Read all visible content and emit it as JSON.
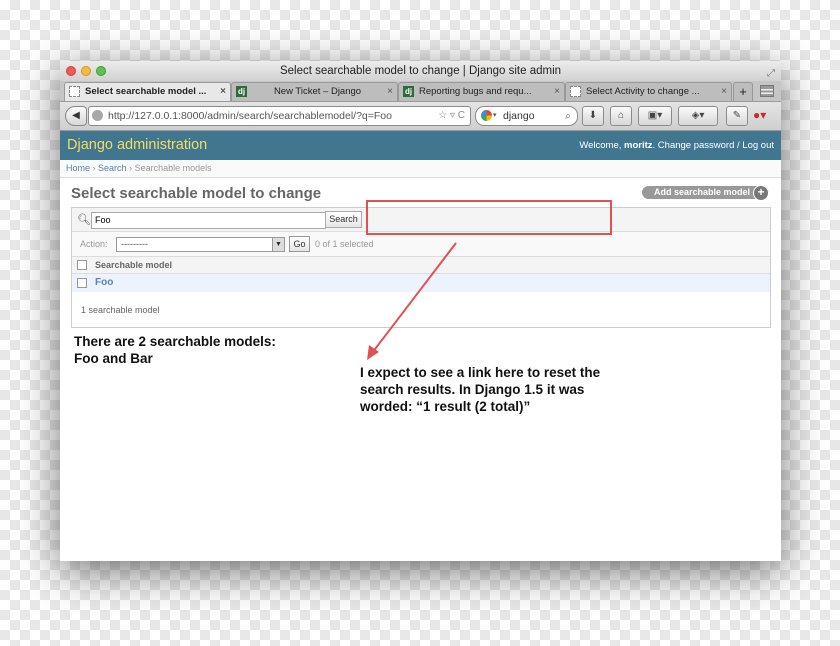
{
  "window": {
    "title": "Select searchable model to change | Django site admin",
    "resize_icon": "resize-icon"
  },
  "tabs": [
    {
      "label": "Select searchable model ...",
      "close": "×",
      "icon": "blank-page-icon",
      "active": true
    },
    {
      "label": "New Ticket – Django",
      "close": "×",
      "icon": "django-icon",
      "active": false
    },
    {
      "label": "Reporting bugs and requ...",
      "close": "×",
      "icon": "django-icon",
      "active": false
    },
    {
      "label": "Select Activity to change ...",
      "close": "×",
      "icon": "blank-page-icon",
      "active": false
    }
  ],
  "tab_plus": "+",
  "navbar": {
    "url": "http://127.0.0.1:8000/admin/search/searchablemodel/?q=Foo",
    "search_engine_text": "django",
    "back_glyph": "◀",
    "url_action_glyphs": "☆ ▿ C"
  },
  "admin": {
    "branding": "Django administration",
    "welcome": "Welcome,",
    "username": "moritz",
    "change_password": "Change password",
    "separator": "/",
    "logout": "Log out"
  },
  "breadcrumbs": {
    "home": "Home",
    "sep": "›",
    "search": "Search",
    "current": "Searchable models"
  },
  "page": {
    "title": "Select searchable model to change",
    "add_button": "Add searchable model",
    "add_plus": "+"
  },
  "search": {
    "value": "Foo",
    "button": "Search"
  },
  "actions": {
    "label": "Action:",
    "selected_option": "---------",
    "go": "Go",
    "selected_count": "0 of 1 selected"
  },
  "table": {
    "column": "Searchable model",
    "rows": [
      "Foo"
    ]
  },
  "paginator": "1 searchable model",
  "annotations": {
    "left": [
      "There are 2 searchable models:",
      "Foo and Bar"
    ],
    "right": [
      "I expect to see a link here to reset the",
      "search results.  In Django 1.5 it was",
      "worded: “1 result (2 total)”"
    ],
    "color": "#e05252"
  }
}
